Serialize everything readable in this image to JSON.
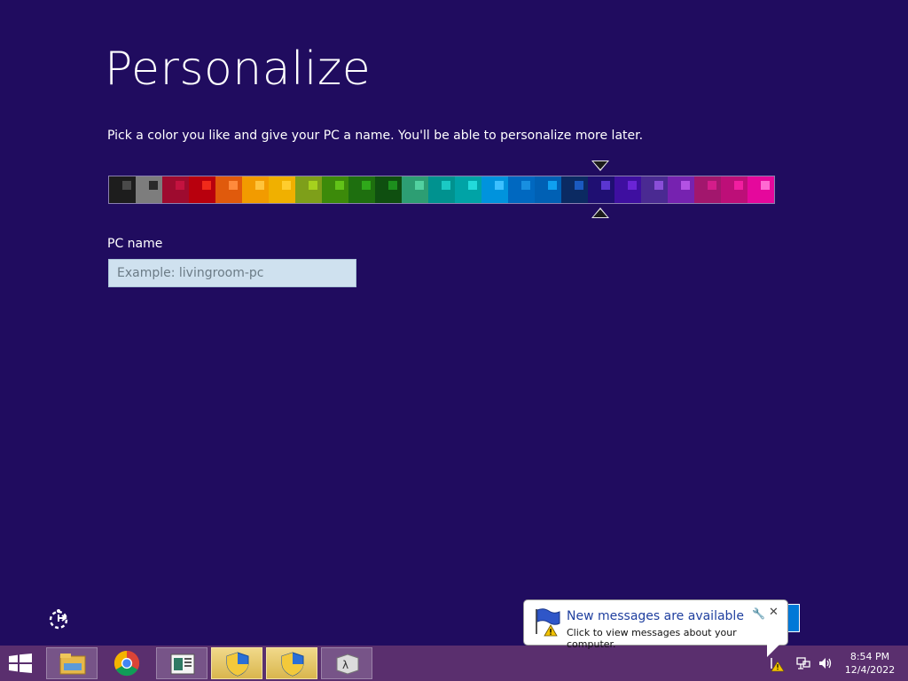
{
  "page": {
    "title": "Personalize",
    "subtitle": "Pick a color you like and give your PC a name. You'll be able to personalize more later.",
    "background": "#200c5f"
  },
  "palette": {
    "swatches": [
      {
        "bg": "#1d1d1d",
        "accent": "#4a4a4a"
      },
      {
        "bg": "#7d7d7d",
        "accent": "#2a2a2a"
      },
      {
        "bg": "#9e0b2f",
        "accent": "#c4123f"
      },
      {
        "bg": "#b8000d",
        "accent": "#f02a1a"
      },
      {
        "bg": "#e05a0c",
        "accent": "#ff8a3c"
      },
      {
        "bg": "#f29b00",
        "accent": "#ffc43c"
      },
      {
        "bg": "#f0b000",
        "accent": "#ffcd2e"
      },
      {
        "bg": "#7e9f1a",
        "accent": "#a6d11e"
      },
      {
        "bg": "#3c8a0a",
        "accent": "#62c218"
      },
      {
        "bg": "#1e6f0f",
        "accent": "#2fa81a"
      },
      {
        "bg": "#0f4f10",
        "accent": "#1d8f1d"
      },
      {
        "bg": "#2d9e73",
        "accent": "#52d1a0"
      },
      {
        "bg": "#00928f",
        "accent": "#1ac9c4"
      },
      {
        "bg": "#00a3a6",
        "accent": "#22dada"
      },
      {
        "bg": "#0093dd",
        "accent": "#3cc0ff"
      },
      {
        "bg": "#0068c0",
        "accent": "#188fe0"
      },
      {
        "bg": "#0060b4",
        "accent": "#0fa0f0"
      },
      {
        "bg": "#0b2a62",
        "accent": "#1b5ac0"
      },
      {
        "bg": "#1f0f72",
        "accent": "#5b36d0"
      },
      {
        "bg": "#3e0fa0",
        "accent": "#6a24d6"
      },
      {
        "bg": "#4a2a92",
        "accent": "#8a4ed8"
      },
      {
        "bg": "#7622b0",
        "accent": "#b352e4"
      },
      {
        "bg": "#a2176d",
        "accent": "#d41d8a"
      },
      {
        "bg": "#bd0f78",
        "accent": "#f21ea0"
      },
      {
        "bg": "#e5089c",
        "accent": "#ff6ad2"
      }
    ],
    "selected_index": 18,
    "border_color": "#8a7fb0"
  },
  "pc_name": {
    "label": "PC name",
    "placeholder": "Example: livingroom-pc",
    "value": ""
  },
  "notification": {
    "title": "New messages are available",
    "text": "Click to view messages about your computer.",
    "flag_icon": "action-center-flag-icon",
    "close_glyph": "✕",
    "wrench_glyph": "🔧"
  },
  "taskbar": {
    "items": [
      {
        "name": "file-explorer-icon",
        "state": "pinned"
      },
      {
        "name": "chrome-icon",
        "state": "none"
      },
      {
        "name": "window-app-icon",
        "state": "pinned"
      },
      {
        "name": "uac-shield-icon",
        "state": "active"
      },
      {
        "name": "uac-shield-icon",
        "state": "active"
      },
      {
        "name": "lambda-app-icon",
        "state": "pinned"
      }
    ],
    "clock_time": "8:54 PM",
    "clock_date": "12/4/2022"
  }
}
